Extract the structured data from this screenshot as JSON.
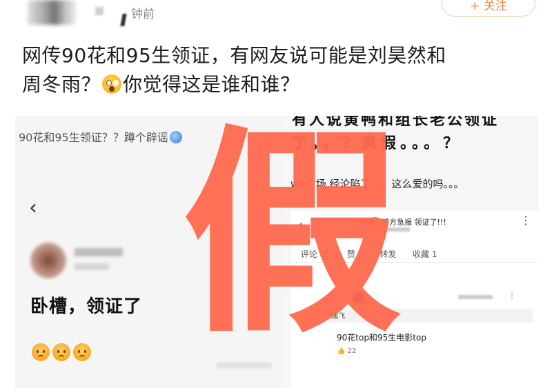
{
  "post": {
    "time_label": "钟前",
    "follow_label": "+ 关注",
    "text_line1": "网传90花和95生领证，有网友说可能是刘昊然和",
    "text_line2_a": "周冬雨？",
    "text_line2_b": "你觉得这是谁和谁？",
    "emoji": "astonished-face-icon"
  },
  "left_screenshot": {
    "caption": "90花和95生领证？？蹲个辟谣",
    "back_icon": "‹",
    "comment": "卧槽，领证了"
  },
  "right_screenshot": {
    "line1": "有人说黄鸭和组长老公领证",
    "line2": "了。。？真假。。。？",
    "line3": "wb广场   经沦陷了。。。这么爱的吗。。。",
    "back_icon": "‹",
    "title": "卧槽，前方急报 领证了!!!",
    "more_icon": "⋮",
    "stats": [
      "评论 25",
      "赞 2",
      "转发",
      "收藏 1"
    ],
    "user_row_text": "逸飞",
    "reply_text": "90花top和95生电影top",
    "like_count": "22"
  },
  "overlay": {
    "stamp_text": "假",
    "color": "#ff6a4f"
  }
}
